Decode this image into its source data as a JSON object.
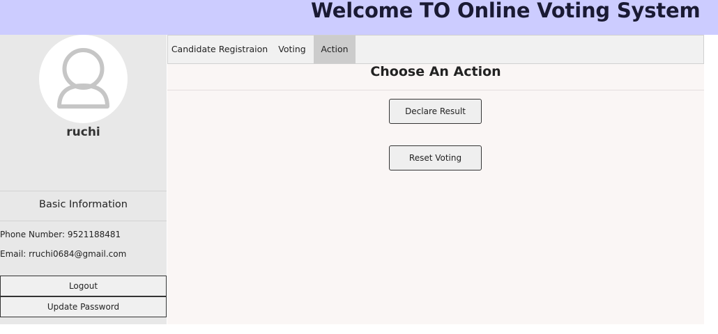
{
  "header": {
    "title": "Welcome TO Online Voting System"
  },
  "sidebar": {
    "avatar_icon": "user-avatar-icon",
    "username": "ruchi",
    "basic_info_title": "Basic Information",
    "phone": "Phone Number: 9521188481",
    "email": "Email: rruchi0684@gmail.com",
    "logout_label": "Logout",
    "update_password_label": "Update Password"
  },
  "tabs": [
    {
      "label": "Candidate Registraion",
      "active": false
    },
    {
      "label": "Voting",
      "active": false
    },
    {
      "label": "Action",
      "active": true
    }
  ],
  "main": {
    "section_title": "Choose An Action",
    "declare_result_label": "Declare Result",
    "reset_voting_label": "Reset Voting"
  },
  "colors": {
    "header_bg": "#ccccff",
    "sidebar_bg": "#e8e8e8",
    "main_bg": "#faf6f5",
    "active_tab_bg": "#cccccc"
  }
}
